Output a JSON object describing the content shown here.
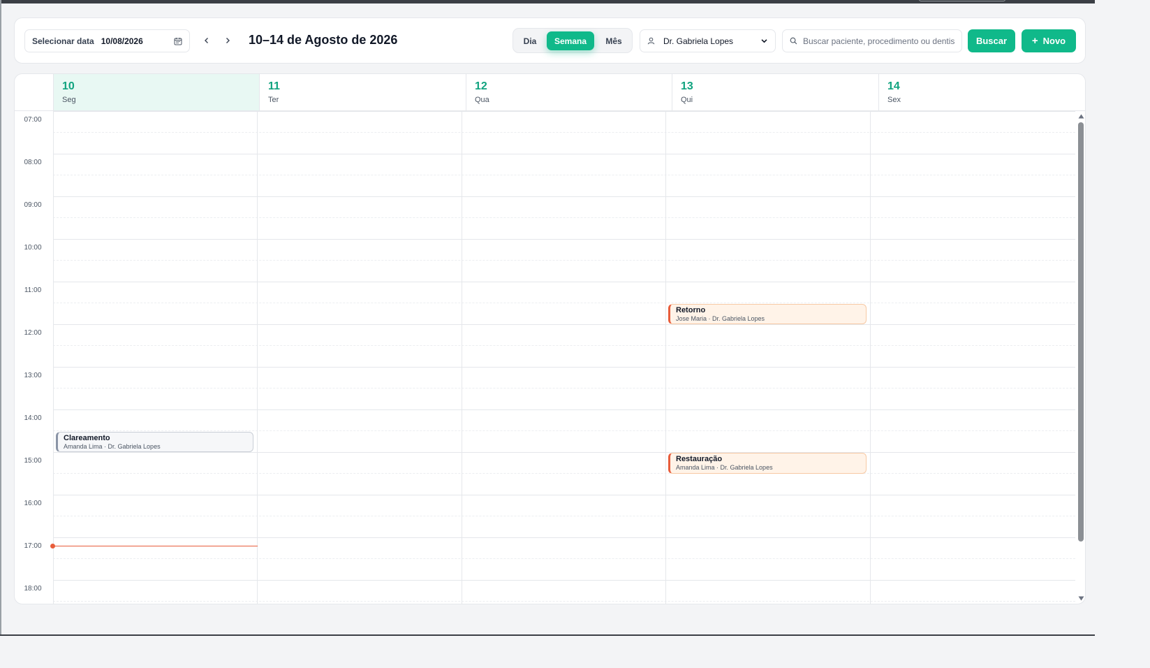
{
  "toolbar": {
    "date_label": "Selecionar data",
    "date_value": "10/08/2026",
    "range_title": "10–14 de Agosto de 2026",
    "views": [
      "Dia",
      "Semana",
      "Mês"
    ],
    "active_view": "Semana",
    "doctor": "Dr. Gabriela Lopes",
    "search_placeholder": "Buscar paciente, procedimento ou dentista",
    "search_button": "Buscar",
    "new_button": "Novo",
    "accent_color": "#10b98a"
  },
  "calendar": {
    "days": [
      {
        "num": "10",
        "weekday": "Seg",
        "today": true
      },
      {
        "num": "11",
        "weekday": "Ter"
      },
      {
        "num": "12",
        "weekday": "Qua"
      },
      {
        "num": "13",
        "weekday": "Qui"
      },
      {
        "num": "14",
        "weekday": "Sex"
      }
    ],
    "hours": [
      "07:00",
      "08:00",
      "09:00",
      "10:00",
      "11:00",
      "12:00",
      "13:00",
      "14:00",
      "15:00",
      "16:00",
      "17:00",
      "18:00"
    ],
    "events": [
      {
        "day": 3,
        "start": "11:30",
        "end": "12:00",
        "title": "Retorno",
        "subtitle": "Jose Maria · Dr. Gabriela Lopes",
        "color": "#e85d3b"
      },
      {
        "day": 0,
        "start": "14:30",
        "end": "15:00",
        "title": "Clareamento",
        "subtitle": "Amanda Lima · Dr. Gabriela Lopes",
        "color": "#8a94a6"
      },
      {
        "day": 3,
        "start": "15:00",
        "end": "15:30",
        "title": "Restauração",
        "subtitle": "Amanda Lima · Dr. Gabriela Lopes",
        "color": "#e85d3b"
      }
    ],
    "now_time": "17:12"
  }
}
